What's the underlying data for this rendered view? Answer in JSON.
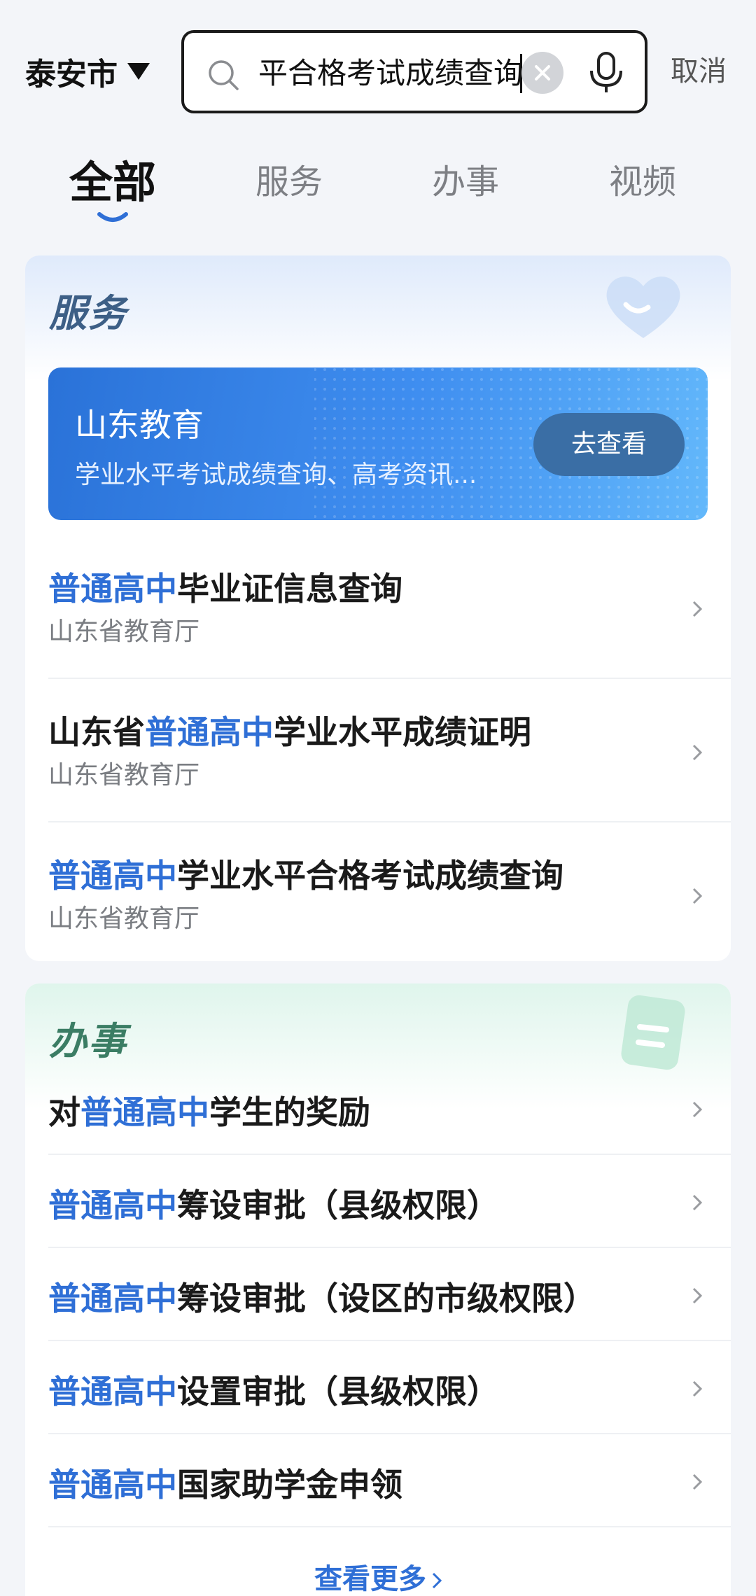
{
  "header": {
    "city": "泰安市",
    "search_value": "平合格考试成绩查询",
    "cancel_label": "取消"
  },
  "tabs": [
    {
      "label": "全部",
      "active": true
    },
    {
      "label": "服务",
      "active": false
    },
    {
      "label": "办事",
      "active": false
    },
    {
      "label": "视频",
      "active": false
    }
  ],
  "service": {
    "title": "服务",
    "banner": {
      "title": "山东教育",
      "subtitle": "学业水平考试成绩查询、高考资讯...",
      "button_label": "去查看"
    },
    "items": [
      {
        "prefix": "",
        "highlight": "普通高中",
        "suffix": "毕业证信息查询",
        "dept": "山东省教育厅"
      },
      {
        "prefix": "山东省",
        "highlight": "普通高中",
        "suffix": "学业水平成绩证明",
        "dept": "山东省教育厅"
      },
      {
        "prefix": "",
        "highlight": "普通高中",
        "suffix": "学业水平合格考试成绩查询",
        "dept": "山东省教育厅"
      }
    ]
  },
  "affairs": {
    "title": "办事",
    "items": [
      {
        "prefix": "对",
        "highlight": "普通高中",
        "suffix": "学生的奖励"
      },
      {
        "prefix": "",
        "highlight": "普通高中",
        "suffix": "筹设审批（县级权限）"
      },
      {
        "prefix": "",
        "highlight": "普通高中",
        "suffix": "筹设审批（设区的市级权限）"
      },
      {
        "prefix": "",
        "highlight": "普通高中",
        "suffix": "设置审批（县级权限）"
      },
      {
        "prefix": "",
        "highlight": "普通高中",
        "suffix": "国家助学金申领"
      }
    ],
    "more_label": "查看更多"
  },
  "colors": {
    "highlight": "#2f6fd6",
    "page_bg": "#f3f5f9",
    "banner_button": "#3a6ea5"
  },
  "icons": {
    "search": "search-icon",
    "clear": "close-icon",
    "mic": "microphone-icon",
    "chevron": "chevron-right-icon"
  }
}
